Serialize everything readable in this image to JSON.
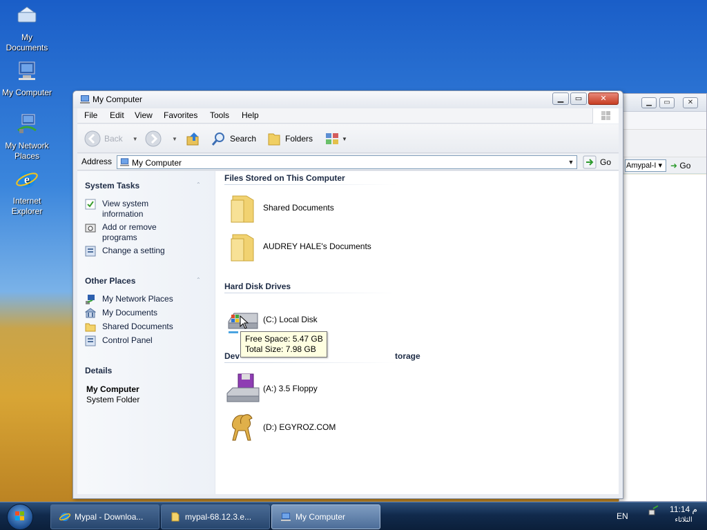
{
  "desktop": {
    "icons": [
      {
        "label": "My Documents"
      },
      {
        "label": "My Computer"
      },
      {
        "label": "My Network Places"
      },
      {
        "label": "Internet Explorer"
      }
    ]
  },
  "background_window": {
    "address_value": "Amypal-I",
    "go_label": "Go"
  },
  "window": {
    "title": "My Computer",
    "menu": [
      "File",
      "Edit",
      "View",
      "Favorites",
      "Tools",
      "Help"
    ],
    "toolbar": {
      "back_label": "Back",
      "search_label": "Search",
      "folders_label": "Folders"
    },
    "address": {
      "label": "Address",
      "value": "My Computer",
      "go_label": "Go"
    },
    "task_pane": {
      "system_tasks": {
        "title": "System Tasks",
        "items": [
          {
            "label": "View system information",
            "icon": "view-info-icon"
          },
          {
            "label": "Add or remove programs",
            "icon": "add-remove-icon"
          },
          {
            "label": "Change a setting",
            "icon": "control-panel-icon"
          }
        ]
      },
      "other_places": {
        "title": "Other Places",
        "items": [
          {
            "label": "My Network Places",
            "icon": "network-icon"
          },
          {
            "label": "My Documents",
            "icon": "documents-icon"
          },
          {
            "label": "Shared Documents",
            "icon": "folder-icon"
          },
          {
            "label": "Control Panel",
            "icon": "control-panel-icon"
          }
        ]
      },
      "details": {
        "title": "Details",
        "name": "My Computer",
        "type": "System Folder"
      }
    },
    "groups": {
      "files_stored": {
        "title": "Files Stored on This Computer",
        "items": [
          {
            "label": "Shared Documents"
          },
          {
            "label": "AUDREY HALE's Documents"
          }
        ]
      },
      "hard_disks": {
        "title": "Hard Disk Drives",
        "items": [
          {
            "label": "(C:) Local Disk"
          }
        ]
      },
      "removable": {
        "title_left": "Dev",
        "title_right": "torage",
        "items": [
          {
            "label": "(A:) 3.5 Floppy"
          },
          {
            "label": "(D:) EGYROZ.COM"
          }
        ]
      }
    },
    "tooltip": {
      "free_space": "Free Space: 5.47 GB",
      "total_size": "Total Size: 7.98 GB"
    }
  },
  "taskbar": {
    "tasks": [
      {
        "label": "Mypal - Downloa...",
        "icon": "ie-icon"
      },
      {
        "label": "mypal-68.12.3.e...",
        "icon": "folder-icon"
      },
      {
        "label": "My Computer",
        "icon": "computer-icon",
        "active": true
      }
    ],
    "language": "EN",
    "time": "11:14 م",
    "day": "الثلاثاء"
  },
  "colors": {
    "accent": "#1c4d8f",
    "tooltip_bg": "#ffffe1",
    "close_button": "#c73d22"
  }
}
